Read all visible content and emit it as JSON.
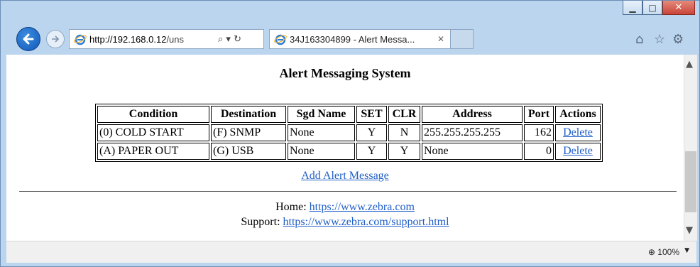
{
  "browser": {
    "address_host": "http://192.168.0.12",
    "address_rest": "/uns",
    "address_controls": "⌕ ▾ ↻",
    "tab_title": "34J163304899 - Alert Messa...",
    "tab_close": "✕",
    "zoom": "100%",
    "icons": [
      "back-arrow-icon",
      "forward-arrow-icon",
      "ie-logo-icon",
      "search-icon",
      "refresh-icon",
      "home-icon",
      "favorites-star-icon",
      "settings-gear-icon",
      "zoom-icon"
    ]
  },
  "page": {
    "title": "Alert Messaging System",
    "table": {
      "headers": [
        "Condition",
        "Destination",
        "Sgd Name",
        "SET",
        "CLR",
        "Address",
        "Port",
        "Actions"
      ],
      "rows": [
        {
          "condition": "(0) COLD START",
          "destination": "(F) SNMP",
          "sgd_name": "None",
          "set": "Y",
          "clr": "N",
          "address": "255.255.255.255",
          "port": "162",
          "action": "Delete"
        },
        {
          "condition": "(A) PAPER OUT",
          "destination": "(G) USB",
          "sgd_name": "None",
          "set": "Y",
          "clr": "Y",
          "address": "None",
          "port": "0",
          "action": "Delete"
        }
      ]
    },
    "add_link": "Add Alert Message",
    "home_label": "Home:",
    "home_url": "https://www.zebra.com",
    "support_label": "Support:",
    "support_url": "https://www.zebra.com/support.html"
  }
}
